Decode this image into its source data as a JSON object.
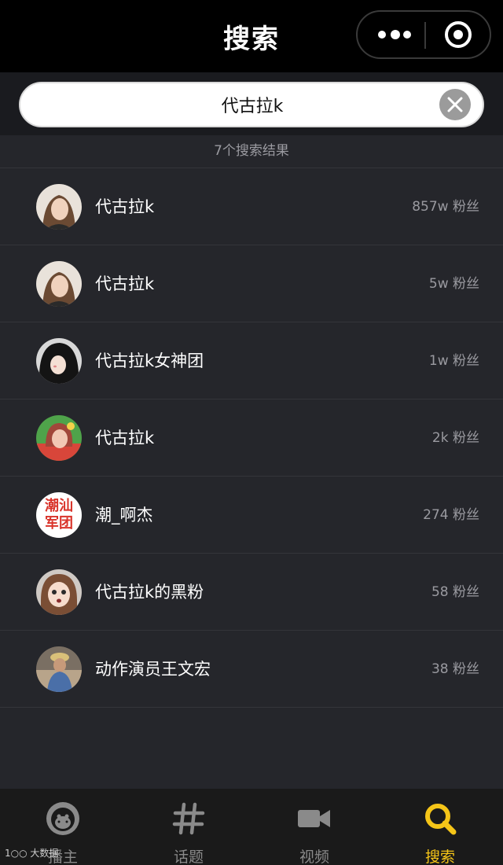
{
  "header": {
    "title": "搜索"
  },
  "search": {
    "value": "代古拉k"
  },
  "results": {
    "count_label": "7个搜索结果",
    "items": [
      {
        "name": "代古拉k",
        "fans": "857w 粉丝",
        "avatar": "avatar-girl-1"
      },
      {
        "name": "代古拉k",
        "fans": "5w 粉丝",
        "avatar": "avatar-girl-1"
      },
      {
        "name": "代古拉k女神团",
        "fans": "1w 粉丝",
        "avatar": "avatar-girl-hooded"
      },
      {
        "name": "代古拉k",
        "fans": "2k 粉丝",
        "avatar": "avatar-girl-red"
      },
      {
        "name": "潮_啊杰",
        "fans": "274 粉丝",
        "avatar": "avatar-text-logo",
        "avatar_text": [
          "潮汕",
          "军团"
        ]
      },
      {
        "name": "代古拉k的黑粉",
        "fans": "58 粉丝",
        "avatar": "avatar-girl-face"
      },
      {
        "name": "动作演员王文宏",
        "fans": "38 粉丝",
        "avatar": "avatar-man-hat"
      }
    ]
  },
  "tabbar": {
    "tabs": [
      {
        "label": "播主",
        "icon": "monkey-face-icon",
        "active": false
      },
      {
        "label": "话题",
        "icon": "hashtag-icon",
        "active": false
      },
      {
        "label": "视频",
        "icon": "video-camera-icon",
        "active": false
      },
      {
        "label": "搜索",
        "icon": "search-icon",
        "active": true
      }
    ]
  },
  "watermark": "大数据",
  "colors": {
    "background": "#25262b",
    "header": "#000000",
    "accent": "#f5c518",
    "muted": "#9a9aa0"
  }
}
